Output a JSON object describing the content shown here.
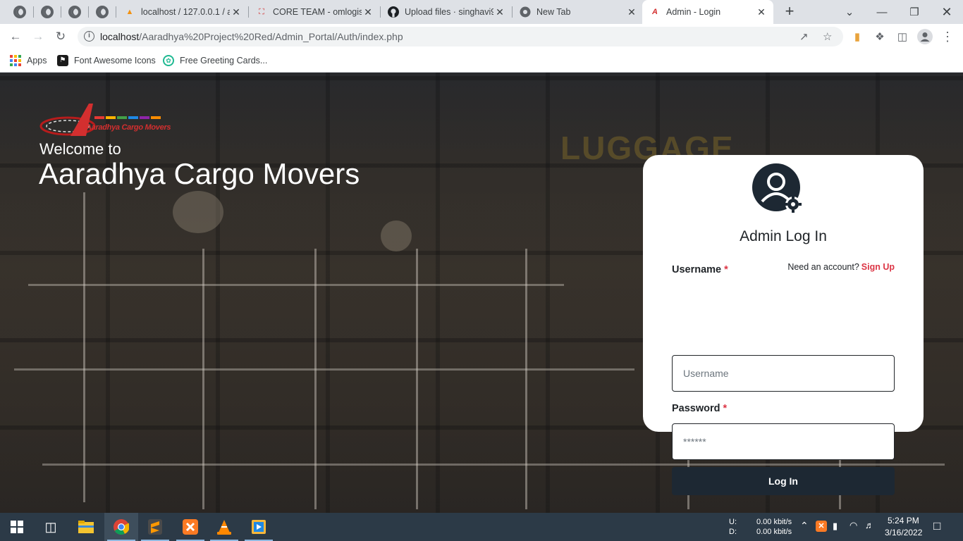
{
  "browser": {
    "tabs": [
      {
        "title": "localhost / 127.0.0.1 / a"
      },
      {
        "title": "CORE TEAM - omlogist"
      },
      {
        "title": "Upload files · singhavi9"
      },
      {
        "title": "New Tab"
      },
      {
        "title": "Admin - Login"
      }
    ],
    "url": "localhost/Aaradhya%20Project%20Red/Admin_Portal/Auth/index.php",
    "url_host": "localhost",
    "url_path": "/Aaradhya%20Project%20Red/Admin_Portal/Auth/index.php",
    "bookmarks": [
      {
        "label": "Apps"
      },
      {
        "label": "Font Awesome Icons"
      },
      {
        "label": "Free Greeting Cards..."
      }
    ]
  },
  "hero": {
    "logo_text": "Aaradhya Cargo Movers",
    "welcome": "Welcome to",
    "company": "Aaradhya Cargo Movers",
    "background_sign": "LUGGAGE"
  },
  "login": {
    "title": "Admin Log In",
    "username_label": "Username",
    "password_label": "Password",
    "required_mark": "*",
    "need_account": "Need an account?",
    "signup_link": "Sign Up",
    "username_placeholder": "Username",
    "password_placeholder": "******",
    "submit": "Log In"
  },
  "taskbar": {
    "net_up_label": "U:",
    "net_down_label": "D:",
    "net_up": "0.00 kbit/s",
    "net_down": "0.00 kbit/s",
    "time": "5:24 PM",
    "date": "3/16/2022"
  },
  "colors": {
    "accent_red": "#dc3545",
    "button_dark": "#1d2833",
    "taskbar": "#2c3a47",
    "chrome_tabstrip": "#dee1e6"
  }
}
